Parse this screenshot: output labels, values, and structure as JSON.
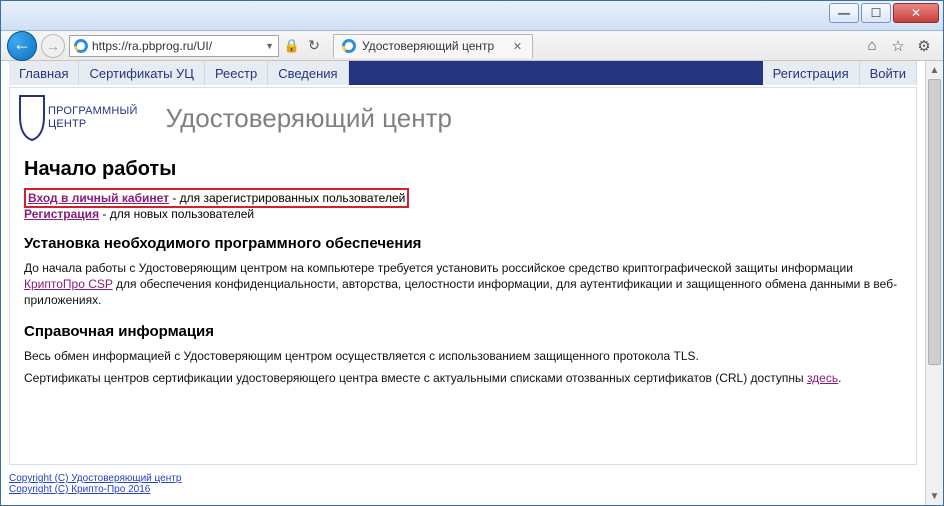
{
  "browser": {
    "address": "https://ra.pbprog.ru/UI/",
    "tab_title": "Удостоверяющий центр"
  },
  "nav": {
    "left": [
      "Главная",
      "Сертификаты УЦ",
      "Реестр",
      "Сведения"
    ],
    "right": [
      "Регистрация",
      "Войти"
    ]
  },
  "brand": {
    "line1": "ПРОГРАММНЫЙ",
    "line2": "ЦЕНТР"
  },
  "page_title": "Удостоверяющий центр",
  "h1": "Начало работы",
  "login": {
    "link": "Вход в личный кабинет",
    "suffix": " - для зарегистрированных пользователей"
  },
  "register": {
    "link": "Регистрация",
    "suffix": " - для новых пользователей"
  },
  "h2_install": "Установка необходимого программного обеспечения",
  "install_pre": "До начала работы с Удостоверяющим центром на компьютере требуется установить российское средство криптографической защиты информации ",
  "install_link": "КриптоПро CSP",
  "install_post": " для обеспечения конфиденциальности, авторства, целостности информации, для аутентификации и защищенного обмена данными в веб-приложениях.",
  "h2_ref": "Справочная информация",
  "ref_p1": "Весь обмен информацией с Удостоверяющим центром осуществляется с использованием защищенного протокола TLS.",
  "ref_p2_pre": "Сертификаты центров сертификации удостоверяющего центра вместе с актуальными списками отозванных сертификатов (CRL) доступны ",
  "ref_p2_link": "здесь",
  "ref_p2_post": ".",
  "footer": {
    "l1": "Copyright (C) Удостоверяющий центр",
    "l2": "Copyright (C) Крипто-Про 2016"
  }
}
